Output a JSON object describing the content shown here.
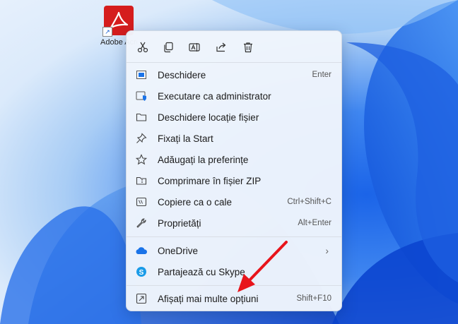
{
  "desktop": {
    "icon_label": "Adobe Acrobat"
  },
  "menu": {
    "toolbar": [
      {
        "name": "cut-icon"
      },
      {
        "name": "copy-icon"
      },
      {
        "name": "rename-icon"
      },
      {
        "name": "share-icon"
      },
      {
        "name": "delete-icon"
      }
    ],
    "items": [
      {
        "label": "Deschidere",
        "shortcut": "Enter",
        "icon": "open-icon"
      },
      {
        "label": "Executare ca administrator",
        "shortcut": "",
        "icon": "admin-shield-icon"
      },
      {
        "label": "Deschidere locație fișier",
        "shortcut": "",
        "icon": "folder-icon"
      },
      {
        "label": "Fixați la Start",
        "shortcut": "",
        "icon": "pin-icon"
      },
      {
        "label": "Adăugați la preferințe",
        "shortcut": "",
        "icon": "star-icon"
      },
      {
        "label": "Comprimare în fișier ZIP",
        "shortcut": "",
        "icon": "zip-icon"
      },
      {
        "label": "Copiere ca o cale",
        "shortcut": "Ctrl+Shift+C",
        "icon": "copy-path-icon"
      },
      {
        "label": "Proprietăți",
        "shortcut": "Alt+Enter",
        "icon": "wrench-icon"
      },
      {
        "label": "OneDrive",
        "shortcut": "",
        "icon": "onedrive-icon"
      },
      {
        "label": "Partajează cu Skype",
        "shortcut": "",
        "icon": "skype-icon"
      },
      {
        "label": "Afișați mai multe opțiuni",
        "shortcut": "Shift+F10",
        "icon": "more-options-icon"
      }
    ],
    "submenu_chevron": "›"
  },
  "colors": {
    "accent": "#0067c0",
    "arrow": "#e8141b",
    "acrobat": "#d51d1d"
  }
}
